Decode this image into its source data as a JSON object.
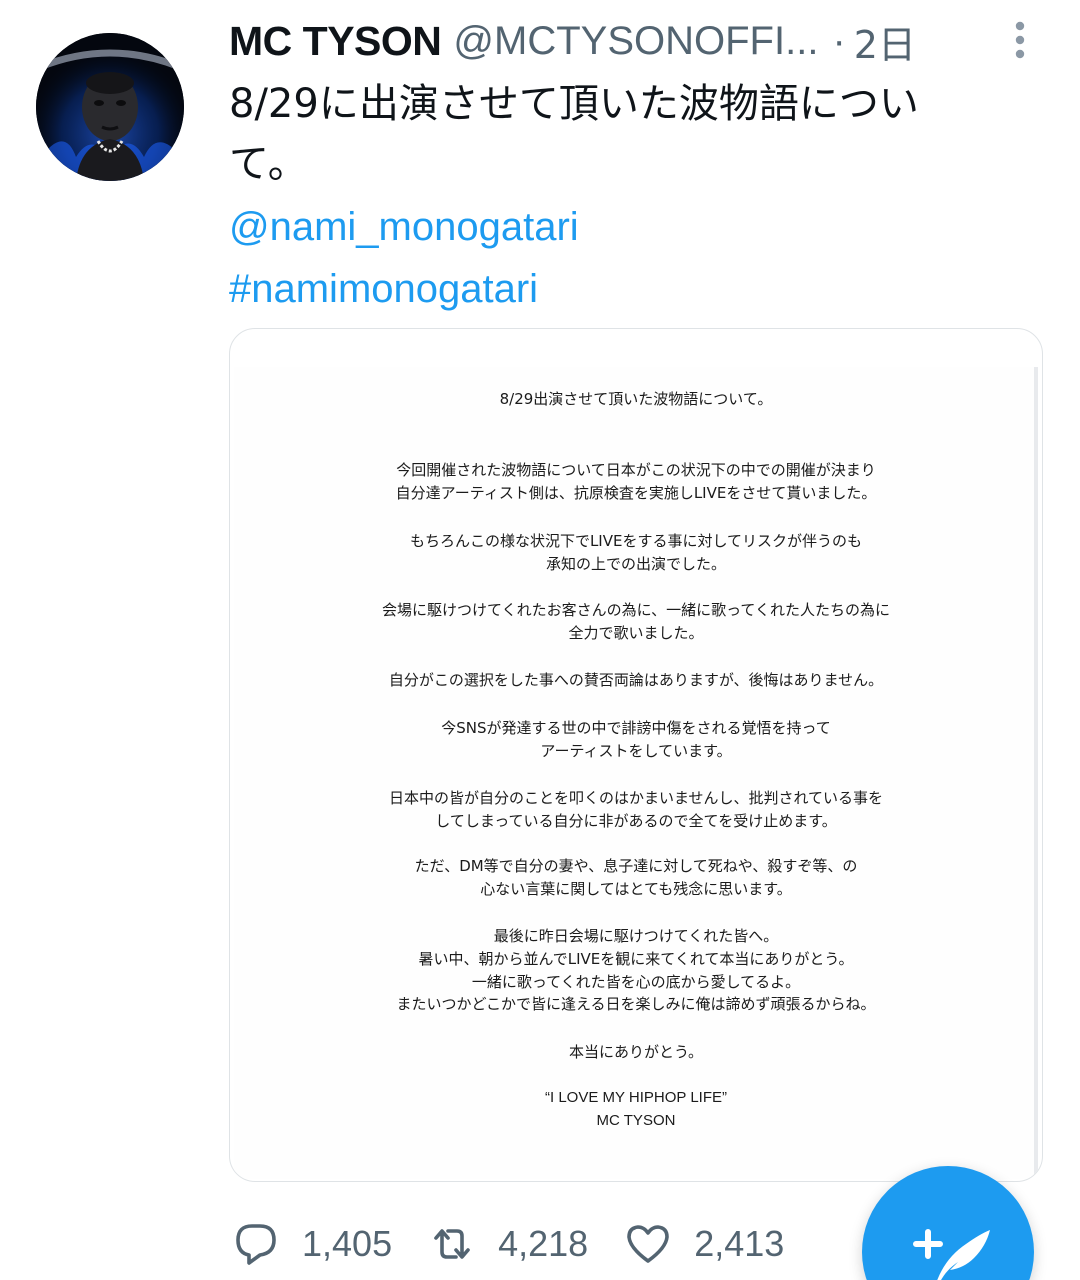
{
  "tweet": {
    "author": {
      "display_name": "MC TYSON",
      "handle": "@MCTYSONOFFI...",
      "avatar_icon": "profile-avatar-icon"
    },
    "separator": "·",
    "time": "2日",
    "text_lines": [
      "8/29に出演させて頂いた波物語につい",
      "て。"
    ],
    "mention": "@nami_monogatari",
    "hashtag": "#namimonogatari",
    "colors": {
      "link": "#1d9bf0",
      "secondary_text": "#536471",
      "fab": "#1d9bf0"
    }
  },
  "letter": {
    "title": "8/29出演させて頂いた波物語について。",
    "paragraphs": [
      [
        "今回開催された波物語について日本がこの状況下の中での開催が決まり",
        "自分達アーティスト側は、抗原検査を実施しLIVEをさせて貰いました。"
      ],
      [
        "もちろんこの様な状況下でLIVEをする事に対してリスクが伴うのも",
        "承知の上での出演でした。"
      ],
      [
        "会場に駆けつけてくれたお客さんの為に、一緒に歌ってくれた人たちの為に",
        "全力で歌いました。"
      ],
      [
        "自分がこの選択をした事への賛否両論はありますが、後悔はありません。"
      ],
      [
        "今SNSが発達する世の中で誹謗中傷をされる覚悟を持って",
        "アーティストをしています。"
      ],
      [
        "日本中の皆が自分のことを叩くのはかまいませんし、批判されている事を",
        "してしまっている自分に非があるので全てを受け止めます。"
      ],
      [
        "ただ、DM等で自分の妻や、息子達に対して死ねや、殺すぞ等、の",
        "心ない言葉に関してはとても残念に思います。"
      ],
      [
        "最後に昨日会場に駆けつけてくれた皆へ。",
        "暑い中、朝から並んでLIVEを観に来てくれて本当にありがとう。",
        "一緒に歌ってくれた皆を心の底から愛してるよ。",
        "またいつかどこかで皆に逢える日を楽しみに俺は諦めず頑張るからね。"
      ],
      [
        "本当にありがとう。"
      ]
    ],
    "quote": "“I LOVE MY HIPHOP LIFE”",
    "signature": "MC TYSON"
  },
  "actions": {
    "reply": {
      "icon": "reply-icon",
      "count": "1,405"
    },
    "retweet": {
      "icon": "retweet-icon",
      "count": "4,218"
    },
    "like": {
      "icon": "heart-icon",
      "count": "2,413"
    },
    "compose": {
      "icon": "compose-tweet-icon"
    }
  }
}
